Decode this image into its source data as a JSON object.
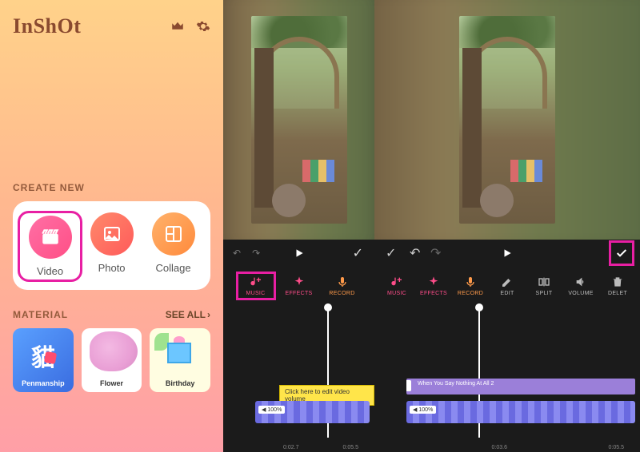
{
  "brand": "InShOt",
  "sections": {
    "create": "CREATE NEW",
    "material": "MATERIAL",
    "see_all": "SEE ALL"
  },
  "create_items": [
    {
      "label": "Video",
      "icon": "clapper-icon",
      "grad": "grad-pink",
      "highlighted": true
    },
    {
      "label": "Photo",
      "icon": "image-icon",
      "grad": "grad-red",
      "highlighted": false
    },
    {
      "label": "Collage",
      "icon": "collage-icon",
      "grad": "grad-orange",
      "highlighted": false
    }
  ],
  "materials": [
    {
      "label": "Penmanship",
      "glyph": "貓",
      "cls": "mat-pen"
    },
    {
      "label": "Flower",
      "cls": "mat-flower"
    },
    {
      "label": "Birthday",
      "cls": "mat-birthday"
    }
  ],
  "pane1": {
    "tools": [
      {
        "label": "MUSIC",
        "icon": "music-plus-icon",
        "cls": "pink",
        "highlighted": true
      },
      {
        "label": "EFFECTS",
        "icon": "sparkle-icon",
        "cls": "pink"
      },
      {
        "label": "RECORD",
        "icon": "mic-icon",
        "cls": "orange"
      }
    ],
    "volume_hint": "Click here to edit video volume",
    "clip_badge": "100%",
    "ticks": [
      "",
      "0:02.7",
      "0:05.5"
    ]
  },
  "pane2": {
    "tools": [
      {
        "label": "MUSIC",
        "icon": "music-plus-icon",
        "cls": "pink"
      },
      {
        "label": "EFFECTS",
        "icon": "sparkle-icon",
        "cls": "pink"
      },
      {
        "label": "RECORD",
        "icon": "mic-icon",
        "cls": "orange"
      },
      {
        "label": "EDIT",
        "icon": "pencil-icon",
        "cls": ""
      },
      {
        "label": "SPLIT",
        "icon": "split-icon",
        "cls": ""
      },
      {
        "label": "VOLUME",
        "icon": "volume-icon",
        "cls": ""
      },
      {
        "label": "DELET",
        "icon": "trash-icon",
        "cls": ""
      }
    ],
    "audio_label": "When You Say Nothing At All 2",
    "clip_badge": "100%",
    "ticks": [
      "",
      "0:03.6",
      "0:05.5"
    ]
  }
}
